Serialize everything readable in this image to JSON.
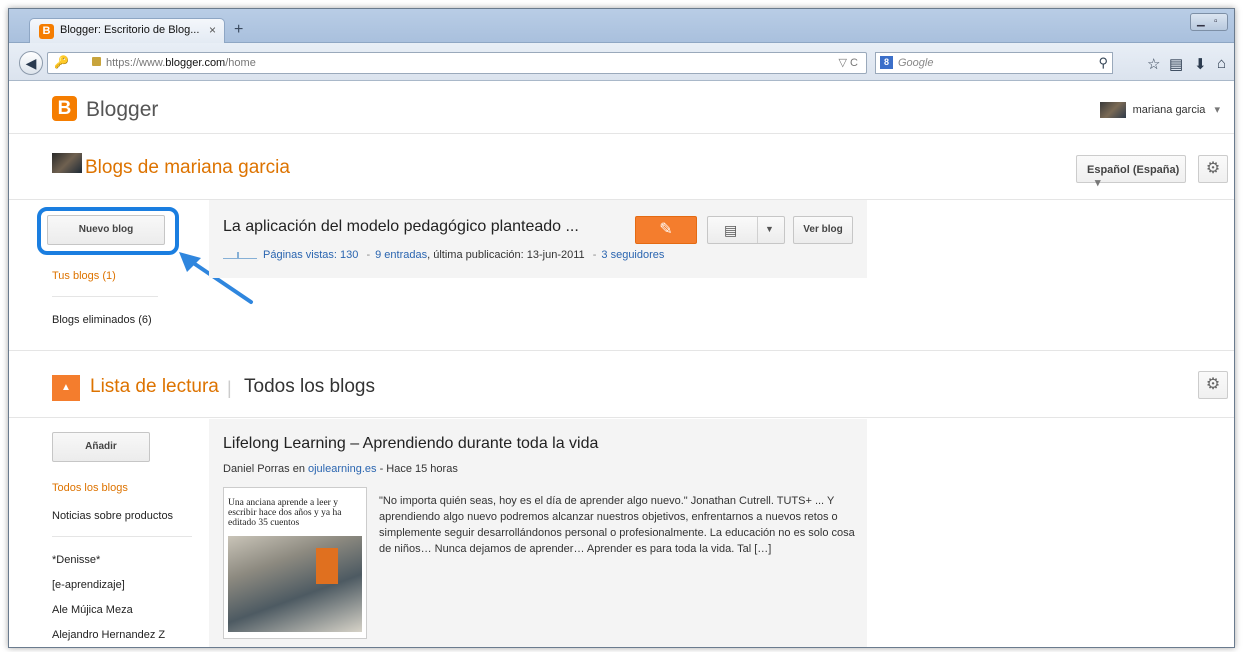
{
  "browser": {
    "tab_title": "Blogger: Escritorio de Blog...",
    "tab_close": "×",
    "new_tab": "+",
    "url_prefix": "https://www.",
    "url_domain": "blogger.com",
    "url_path": "/home",
    "url_right": "▽ C",
    "search_engine_letter": "8",
    "search_placeholder": "Google"
  },
  "header": {
    "logo_letter": "B",
    "logo_text": "Blogger",
    "user_name": "mariana garcia",
    "user_caret": "▾"
  },
  "blogs_section": {
    "title": "Blogs de mariana garcia",
    "language_button": "Español (España)",
    "language_caret": "▾"
  },
  "sidebar": {
    "new_blog_button": "Nuevo blog",
    "your_blogs": "Tus blogs (1)",
    "deleted_blogs": "Blogs eliminados (6)"
  },
  "blog": {
    "title": "La aplicación del modelo pedagógico planteado ...",
    "page_views": "Páginas vistas: 130",
    "sep1": "-",
    "entries": "9 entradas",
    "last_post": ", última publicación: 13-jun-2011",
    "sep2": "-",
    "followers": "3 seguidores",
    "view_button": "Ver blog"
  },
  "reading_list": {
    "collapse_glyph": "▲",
    "title": "Lista de lectura",
    "separator": "|",
    "subtitle": "Todos los blogs",
    "add_button": "Añadir",
    "nav_items": [
      "Todos los blogs",
      "Noticias sobre productos"
    ],
    "blogs": [
      "*Denisse*",
      "[e-aprendizaje]",
      "Ale Mújica Meza",
      "Alejandro Hernandez Z"
    ]
  },
  "post": {
    "title": "Lifelong Learning – Aprendiendo durante toda la vida",
    "author_prefix": "Daniel Porras en",
    "source_link": "ojulearning.es",
    "time": "- Hace 15 horas",
    "thumb_headline": "Una anciana aprende a leer y escribir hace dos años y ya ha editado 35 cuentos",
    "excerpt": "\"No importa quién seas, hoy es el día de aprender algo nuevo.\" Jonathan Cutrell. TUTS+ ... Y aprendiendo algo nuevo podremos alcanzar nuestros objetivos, enfrentarnos a nuevos retos o simplemente seguir desarrollándonos personal o profesionalmente. La educación no es solo cosa de niños… Nunca dejamos de aprender… Aprender es para toda la vida. Tal […]"
  },
  "colors": {
    "accent_orange": "#dd7300",
    "button_orange": "#f47d2d",
    "highlight_blue": "#1a7ee0",
    "link_blue": "#2a65b0"
  }
}
